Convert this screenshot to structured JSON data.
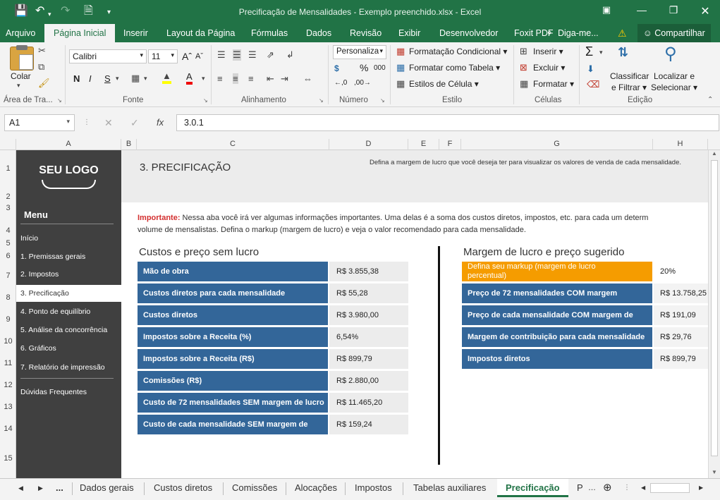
{
  "window": {
    "title": "Precificação de Mensalidades - Exemplo preenchido.xlsx - Excel"
  },
  "ribbon_tabs": [
    "Arquivo",
    "Página Inicial",
    "Inserir",
    "Layout da Página",
    "Fórmulas",
    "Dados",
    "Revisão",
    "Exibir",
    "Desenvolvedor",
    "Foxit PDF"
  ],
  "tell_me": "Diga-me...",
  "share": "Compartilhar",
  "ribbon": {
    "clipboard": {
      "paste": "Colar",
      "group": "Área de Tra..."
    },
    "font": {
      "name": "Calibri",
      "size": "11",
      "bold": "N",
      "italic": "I",
      "underline": "S",
      "group": "Fonte"
    },
    "alignment": {
      "group": "Alinhamento"
    },
    "number": {
      "format": "Personaliza",
      "currency": "$",
      "percent": "%",
      "thousands": "000",
      "group": "Número"
    },
    "styles": {
      "conditional": "Formatação Condicional",
      "as_table": "Formatar como Tabela",
      "cell_styles": "Estilos de Célula",
      "group": "Estilo"
    },
    "cells": {
      "insert": "Inserir",
      "delete": "Excluir",
      "format": "Formatar",
      "group": "Células"
    },
    "editing": {
      "sort1": "Classificar",
      "sort2": "e Filtrar",
      "find1": "Localizar e",
      "find2": "Selecionar",
      "group": "Edição"
    }
  },
  "formula_bar": {
    "name_box": "A1",
    "fx": "fx",
    "value": "3.0.1"
  },
  "columns": [
    "A",
    "B",
    "C",
    "D",
    "E",
    "F",
    "G",
    "H"
  ],
  "rows": [
    "1",
    "2",
    "3",
    "4",
    "5",
    "6",
    "7",
    "8",
    "9",
    "10",
    "11",
    "12",
    "13",
    "14",
    "15"
  ],
  "sidebar": {
    "logo": "SEU LOGO",
    "menu_title": "Menu",
    "items": [
      "Início",
      "1. Premissas gerais",
      "2. Impostos",
      "3. Precificação",
      "4. Ponto de equilíbrio",
      "5. Análise da concorrência",
      "6. Gráficos",
      "7. Relatório de impressão",
      "Dúvidas Frequentes"
    ]
  },
  "page": {
    "title": "3. PRECIFICAÇÃO",
    "hint": "Defina a margem de lucro que você deseja ter para visualizar os valores de venda de cada mensalidade.",
    "important_label": "Importante:",
    "important_text": " Nessa aba você irá ver algumas informações importantes. Uma delas é a soma dos custos diretos, impostos, etc. para cada um determ",
    "important_text2": "volume de mensalistas. Defina o markup (margem de lucro) e veja o valor recomendado para cada mensalidade."
  },
  "left_table": {
    "title": "Custos e preço sem lucro",
    "rows": [
      {
        "label": "Mão de obra",
        "value": "R$ 3.855,38"
      },
      {
        "label": "Custos diretos para cada mensalidade",
        "value": "R$ 55,28"
      },
      {
        "label": "Custos diretos",
        "value": "R$ 3.980,00"
      },
      {
        "label": "Impostos sobre a Receita (%)",
        "value": "6,54%"
      },
      {
        "label": "Impostos sobre a Receita (R$)",
        "value": "R$ 899,79"
      },
      {
        "label": "Comissões (R$)",
        "value": "R$ 2.880,00"
      },
      {
        "label": "Custo de 72 mensalidades SEM margem de lucro",
        "value": "R$ 11.465,20"
      },
      {
        "label": "Custo de cada mensalidade SEM margem de lucro",
        "value": "R$ 159,24"
      }
    ]
  },
  "right_table": {
    "title": "Margem de lucro e preço sugerido",
    "markup_label1": "Defina seu markup (margem de lucro",
    "markup_label2": "percentual)",
    "markup_value": "20%",
    "markup_color": "#f59c00",
    "rows": [
      {
        "label": "Preço de 72 mensalidades COM margem",
        "value": "R$ 13.758,25"
      },
      {
        "label": "Preço de cada mensalidade COM margem de lucro",
        "value": "R$ 191,09"
      },
      {
        "label": "Margem de contribuição para cada mensalidade",
        "value": "R$ 29,76"
      },
      {
        "label": "Impostos diretos",
        "value": "R$ 899,79"
      }
    ]
  },
  "sheet_tabs": [
    "Dados gerais",
    "Custos diretos",
    "Comissões",
    "Alocações",
    "Impostos",
    "Tabelas auxiliares",
    "Precificação",
    "P"
  ],
  "sheet_nav": {
    "ellipsis": "..."
  },
  "colors": {
    "excel_green": "#217346",
    "label_blue": "#336699",
    "sidebar_dark": "#404040"
  }
}
